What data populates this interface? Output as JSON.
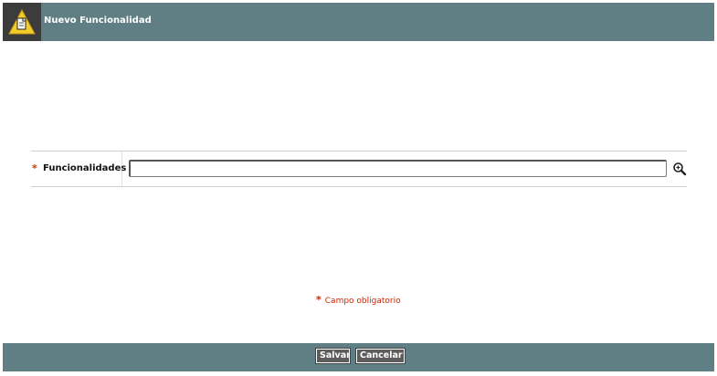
{
  "window": {
    "title": "Nuevo Funcionalidad",
    "icon": "warning-document-icon"
  },
  "form": {
    "fields": [
      {
        "required_marker": "*",
        "label": "Funcionalidades",
        "value": "",
        "search_icon": "magnifier-plus-icon"
      }
    ]
  },
  "legend": {
    "marker": "*",
    "text": "Campo obligatorio"
  },
  "footer": {
    "save_label": "Salvar",
    "cancel_label": "Cancelar"
  },
  "colors": {
    "header_bar": "#607f85",
    "icon_box": "#3c3c3c",
    "required": "#cc3300",
    "button": "#5c5c5c"
  }
}
